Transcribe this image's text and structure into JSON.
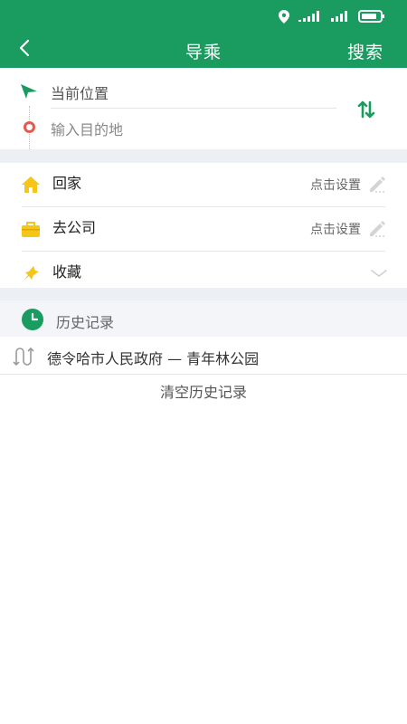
{
  "colors": {
    "primary": "#1a9b5f",
    "background_gap": "#eceff3",
    "home_icon": "#f5c518",
    "company_icon": "#f5c518",
    "favorite_icon": "#f5c518",
    "destination_dot": "#e25b4f"
  },
  "status_bar": {
    "icons": [
      "location-icon",
      "signal-icon",
      "signal-icon",
      "battery-icon"
    ]
  },
  "header": {
    "title": "导乘",
    "search_label": "搜索",
    "back_icon": "back-arrow-icon"
  },
  "route": {
    "from_placeholder": "当前位置",
    "to_placeholder": "输入目的地",
    "swap_icon": "swap-icon"
  },
  "shortcuts": [
    {
      "label": "回家",
      "action": "点击设置",
      "icon": "home-icon"
    },
    {
      "label": "去公司",
      "action": "点击设置",
      "icon": "briefcase-icon"
    },
    {
      "label": "收藏",
      "icon": "favorite-icon"
    }
  ],
  "history": {
    "title": "历史记录",
    "items": [
      {
        "text": "德令哈市人民政府 — 青年林公园",
        "icon": "route-icon"
      }
    ],
    "clear_label": "清空历史记录"
  }
}
